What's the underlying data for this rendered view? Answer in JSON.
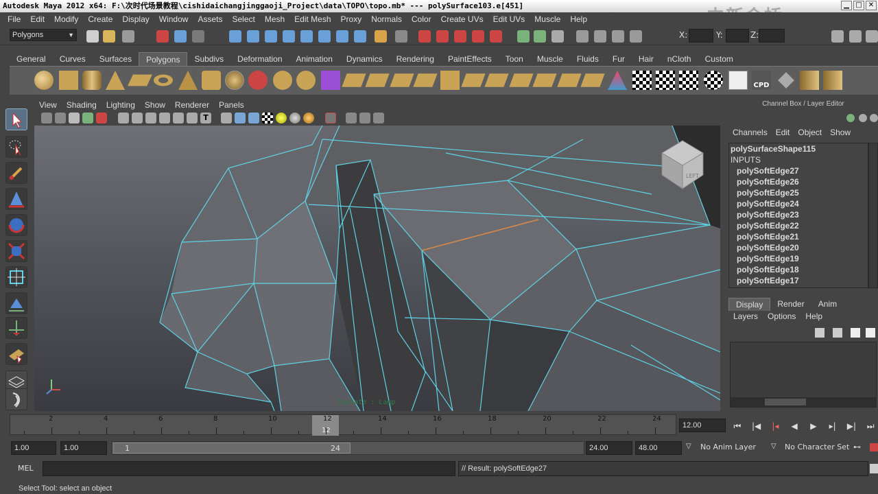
{
  "window": {
    "title": "Autodesk Maya 2012 x64: F:\\次时代场景教程\\cishidaichangjinggaoji_Project\\data\\TOPO\\topo.mb*   ---   polySurface103.e[451]",
    "watermark": "中新金桥"
  },
  "menubar": [
    "File",
    "Edit",
    "Modify",
    "Create",
    "Display",
    "Window",
    "Assets",
    "Select",
    "Mesh",
    "Edit Mesh",
    "Proxy",
    "Normals",
    "Color",
    "Create UVs",
    "Edit UVs",
    "Muscle",
    "Help"
  ],
  "statusline": {
    "menuset": "Polygons",
    "x_label": "X:",
    "y_label": "Y:",
    "z_label": "Z:"
  },
  "shelf": {
    "tabs": [
      "General",
      "Curves",
      "Surfaces",
      "Polygons",
      "Subdivs",
      "Deformation",
      "Animation",
      "Dynamics",
      "Rendering",
      "PaintEffects",
      "Toon",
      "Muscle",
      "Fluids",
      "Fur",
      "Hair",
      "nCloth",
      "Custom"
    ],
    "active_tab": "Polygons",
    "cpd_label": "CPD"
  },
  "viewport": {
    "menu": [
      "View",
      "Shading",
      "Lighting",
      "Show",
      "Renderer",
      "Panels"
    ],
    "hud_text": "Isolate : Lamp",
    "viewcube_label": "LEFT",
    "colors": {
      "wire": "#5fd3e6",
      "selected_edge": "#d98a4a",
      "face": "#606165"
    }
  },
  "channel_box": {
    "title": "Channel Box / Layer Editor",
    "menu": [
      "Channels",
      "Edit",
      "Object",
      "Show"
    ],
    "node": "polySurfaceShape115",
    "inputs_label": "INPUTS",
    "inputs": [
      "polySoftEdge27",
      "polySoftEdge26",
      "polySoftEdge25",
      "polySoftEdge24",
      "polySoftEdge23",
      "polySoftEdge22",
      "polySoftEdge21",
      "polySoftEdge20",
      "polySoftEdge19",
      "polySoftEdge18",
      "polySoftEdge17"
    ]
  },
  "layer_editor": {
    "tabs": [
      "Display",
      "Render",
      "Anim"
    ],
    "active_tab": "Display",
    "menu": [
      "Layers",
      "Options",
      "Help"
    ]
  },
  "timeline": {
    "ticks": [
      "2",
      "4",
      "6",
      "8",
      "10",
      "12",
      "14",
      "16",
      "18",
      "20",
      "22",
      "24"
    ],
    "current_frame_marker": "12",
    "current_frame": "12.00"
  },
  "range": {
    "start": "1.00",
    "playback_start": "1.00",
    "range_start": "1",
    "range_end": "24",
    "playback_end": "24.00",
    "end": "48.00",
    "anim_layer": "No Anim Layer",
    "character_set": "No Character Set"
  },
  "command": {
    "label": "MEL",
    "result": "// Result: polySoftEdge27"
  },
  "help_line": "Select Tool: select an object"
}
